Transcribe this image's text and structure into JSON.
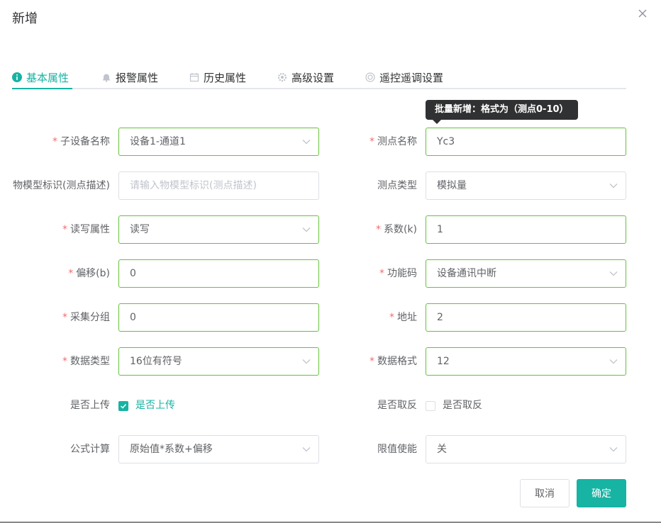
{
  "dialog": {
    "title": "新增",
    "close_icon": "close-icon",
    "tooltip": "批量新增：格式为（测点0-10）"
  },
  "tabs": [
    {
      "label": "基本属性",
      "icon": "info-icon",
      "active": true
    },
    {
      "label": "报警属性",
      "icon": "bell-icon",
      "active": false
    },
    {
      "label": "历史属性",
      "icon": "calendar-icon",
      "active": false
    },
    {
      "label": "高级设置",
      "icon": "gear-icon",
      "active": false
    },
    {
      "label": "遥控遥调设置",
      "icon": "circle-settings-icon",
      "active": false
    }
  ],
  "form": {
    "left": [
      {
        "label": "子设备名称",
        "required": true,
        "value": "设备1-通道1",
        "type": "select"
      },
      {
        "label": "物模型标识(测点描述)",
        "required": false,
        "value": "",
        "placeholder": "请输入物模型标识(测点描述)",
        "type": "input"
      },
      {
        "label": "读写属性",
        "required": true,
        "value": "读写",
        "type": "select"
      },
      {
        "label": "偏移(b)",
        "required": true,
        "value": "0",
        "type": "input"
      },
      {
        "label": "采集分组",
        "required": true,
        "value": "0",
        "type": "input"
      },
      {
        "label": "数据类型",
        "required": true,
        "value": "16位有符号",
        "type": "select"
      },
      {
        "label": "是否上传",
        "required": false,
        "value": "是否上传",
        "type": "checkbox",
        "checked": true
      },
      {
        "label": "公式计算",
        "required": false,
        "value": "原始值*系数+偏移",
        "type": "select"
      }
    ],
    "right": [
      {
        "label": "测点名称",
        "required": true,
        "value": "Yc3",
        "type": "input"
      },
      {
        "label": "测点类型",
        "required": false,
        "value": "模拟量",
        "type": "select"
      },
      {
        "label": "系数(k)",
        "required": true,
        "value": "1",
        "type": "input"
      },
      {
        "label": "功能码",
        "required": true,
        "value": "设备通讯中断",
        "type": "select"
      },
      {
        "label": "地址",
        "required": true,
        "value": "2",
        "type": "input"
      },
      {
        "label": "数据格式",
        "required": true,
        "value": "12",
        "type": "select"
      },
      {
        "label": "是否取反",
        "required": false,
        "value": "是否取反",
        "type": "checkbox",
        "checked": false
      },
      {
        "label": "限值使能",
        "required": false,
        "value": "关",
        "type": "select"
      }
    ]
  },
  "footer": {
    "cancel_label": "取消",
    "confirm_label": "确定"
  },
  "colors": {
    "accent": "#17b3a3",
    "valid_border": "#67c23a",
    "required": "#f56c6c"
  }
}
